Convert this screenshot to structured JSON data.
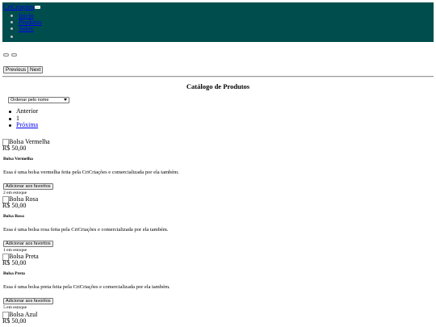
{
  "navbar": {
    "brand": "CriCriações",
    "color": "#004d4d",
    "links": [
      "Início",
      "Produtos",
      "Sobre"
    ]
  },
  "carousel": {
    "prev_label": "Previous",
    "next_label": "Next"
  },
  "catalog": {
    "title": "Catálogo de Produtos",
    "sort_selected": "Ordenar pelo nome",
    "pagination": {
      "prev": "Anterior",
      "current": "1",
      "next": "Próxima"
    }
  },
  "products": [
    {
      "img_alt": "Bolsa Vermelha",
      "price": "R$ 50,00",
      "name": "Bolsa Vermelha",
      "description": "Essa é uma bolsa vermelha feita pela CriCriações e comercializada por ela também.",
      "fav_label": "Adicionar aos favoritos",
      "stock": "2 em estoque"
    },
    {
      "img_alt": "Bolsa Rosa",
      "price": "R$ 50,00",
      "name": "Bolsa Rosa",
      "description": "Essa é uma bolsa rosa feita pela CriCriações e comercializada por ela também.",
      "fav_label": "Adicionar aos favoritos",
      "stock": "1 em estoque"
    },
    {
      "img_alt": "Bolsa Preta",
      "price": "R$ 50,00",
      "name": "Bolsa Preta",
      "description": "Essa é uma bolsa preta feita pela CriCriações e comercializada por ela também.",
      "fav_label": "Adicionar aos favoritos",
      "stock": "5 em estoque"
    },
    {
      "img_alt": "Bolsa Azul",
      "price": "R$ 50,00"
    }
  ]
}
